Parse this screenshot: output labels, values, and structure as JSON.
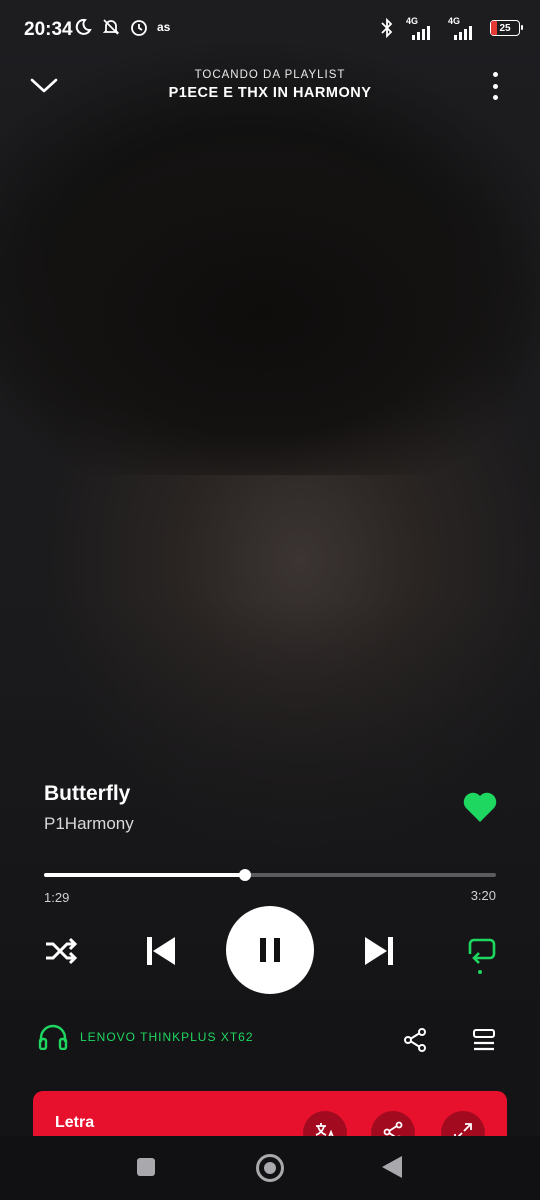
{
  "status": {
    "time": "20:34",
    "icons": [
      "moon-icon",
      "muted-bell-icon",
      "alarm-icon",
      "lastfm-icon"
    ],
    "network_1": "4G",
    "network_2": "4G",
    "battery": "25"
  },
  "header": {
    "subtitle": "TOCANDO DA PLAYLIST",
    "title": "P1ECE E THX IN HARMONY"
  },
  "track": {
    "title": "Butterfly",
    "artist": "P1Harmony",
    "liked": true
  },
  "progress": {
    "elapsed": "1:29",
    "total": "3:20",
    "fraction": 0.445
  },
  "controls": {
    "shuffle": "shuffle-icon",
    "previous": "skip-previous-icon",
    "play_state": "playing",
    "next": "skip-next-icon",
    "repeat": "repeat-icon"
  },
  "device": {
    "name": "LENOVO THINKPLUS XT62"
  },
  "lyrics": {
    "label": "Letra"
  },
  "colors": {
    "accent_green": "#1ed760",
    "lyrics_red": "#e8112d"
  }
}
